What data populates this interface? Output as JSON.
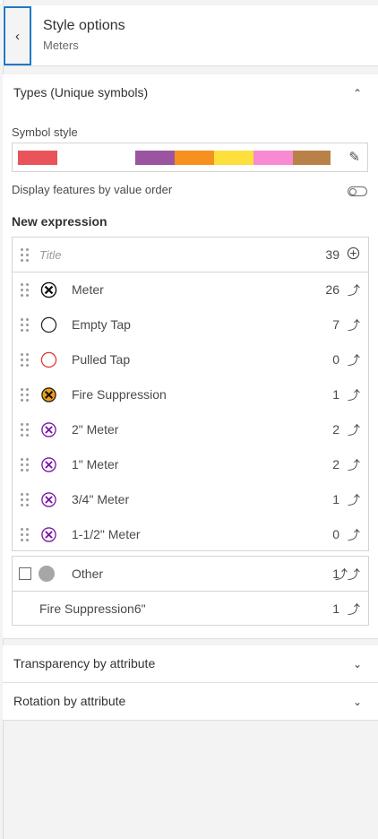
{
  "header": {
    "title": "Style options",
    "subtitle": "Meters",
    "back_icon": "chevron-left-icon"
  },
  "types_section": {
    "title": "Types (Unique symbols)",
    "chevron": "chevron-up-icon",
    "symbol_style_label": "Symbol style",
    "ramp_colors": [
      "#e8545a",
      "#ffffff",
      "#ffffff",
      "#9b54a0",
      "#f7901e",
      "#fde03d",
      "#f78ad2",
      "#b98148"
    ],
    "edit_icon": "pencil-icon",
    "display_order_label": "Display features by value order",
    "display_order_on": false,
    "expression_title": "New expression",
    "title_row": {
      "placeholder": "Title",
      "count": "39",
      "action_icon": "add-circle-icon"
    },
    "rows": [
      {
        "label": "Meter",
        "count": "26",
        "symbol": "x-circle-black",
        "action_icon": "move-up-icon"
      },
      {
        "label": "Empty Tap",
        "count": "7",
        "symbol": "circle-black-outline",
        "action_icon": "move-up-icon"
      },
      {
        "label": "Pulled Tap",
        "count": "0",
        "symbol": "circle-red-outline",
        "action_icon": "move-up-icon"
      },
      {
        "label": "Fire Suppression",
        "count": "1",
        "symbol": "x-circle-orange",
        "action_icon": "move-up-icon"
      },
      {
        "label": "2\" Meter",
        "count": "2",
        "symbol": "x-circle-purple",
        "action_icon": "move-up-icon"
      },
      {
        "label": "1\" Meter",
        "count": "2",
        "symbol": "x-circle-purple",
        "action_icon": "move-up-icon"
      },
      {
        "label": "3/4\" Meter",
        "count": "1",
        "symbol": "x-circle-purple",
        "action_icon": "move-up-icon"
      },
      {
        "label": "1-1/2\" Meter",
        "count": "0",
        "symbol": "x-circle-purple",
        "action_icon": "move-up-icon"
      }
    ],
    "other": {
      "label": "Other",
      "count": "1",
      "action_icon": "move-up-double-icon",
      "checked": false
    },
    "extra_row": {
      "label": "Fire Suppression6\"",
      "count": "1",
      "action_icon": "move-up-icon"
    }
  },
  "transparency_section": {
    "title": "Transparency by attribute",
    "chevron": "chevron-down-icon"
  },
  "rotation_section": {
    "title": "Rotation by attribute",
    "chevron": "chevron-down-icon"
  }
}
